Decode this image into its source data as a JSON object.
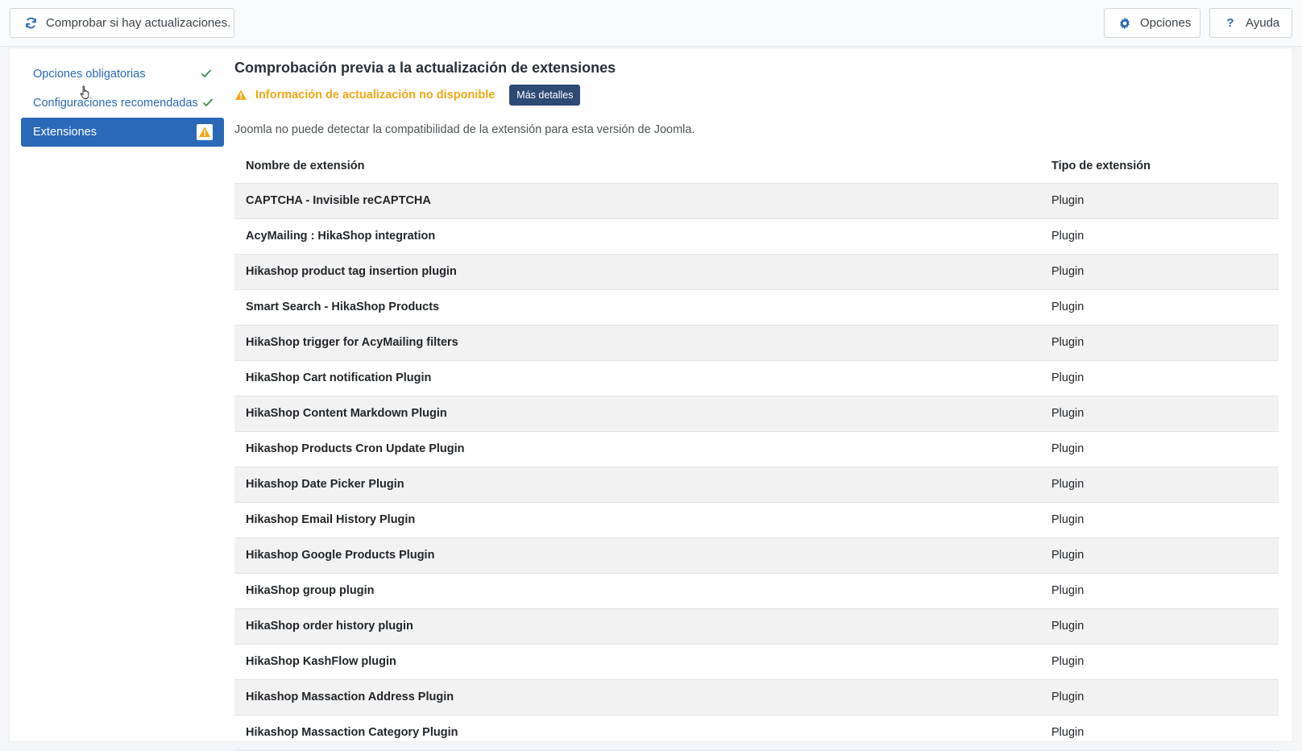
{
  "toolbar": {
    "check_updates_label": "Comprobar si hay actualizaciones.",
    "check_updates_icon": "sync-icon",
    "options_label": "Opciones",
    "options_icon": "gear-icon",
    "help_label": "Ayuda",
    "help_icon": "question-icon"
  },
  "sidebar": {
    "items": [
      {
        "label": "Opciones obligatorias",
        "status": "ok"
      },
      {
        "label": "Configuraciones recomendadas",
        "status": "ok"
      },
      {
        "label": "Extensiones",
        "status": "warning",
        "active": true
      }
    ]
  },
  "main": {
    "title": "Comprobación previa a la actualización de extensiones",
    "warning_text": "Información de actualización no disponible",
    "details_button": "Más detalles",
    "description": "Joomla no puede detectar la compatibilidad de la extensión para esta versión de Joomla.",
    "table": {
      "headers": {
        "name": "Nombre de extensión",
        "type": "Tipo de extensión"
      },
      "rows": [
        {
          "name": "CAPTCHA - Invisible reCAPTCHA",
          "type": "Plugin"
        },
        {
          "name": "AcyMailing : HikaShop integration",
          "type": "Plugin"
        },
        {
          "name": "Hikashop product tag insertion plugin",
          "type": "Plugin"
        },
        {
          "name": "Smart Search - HikaShop Products",
          "type": "Plugin"
        },
        {
          "name": "HikaShop trigger for AcyMailing filters",
          "type": "Plugin"
        },
        {
          "name": "HikaShop Cart notification Plugin",
          "type": "Plugin"
        },
        {
          "name": "HikaShop Content Markdown Plugin",
          "type": "Plugin"
        },
        {
          "name": "Hikashop Products Cron Update Plugin",
          "type": "Plugin"
        },
        {
          "name": "Hikashop Date Picker Plugin",
          "type": "Plugin"
        },
        {
          "name": "Hikashop Email History Plugin",
          "type": "Plugin"
        },
        {
          "name": "Hikashop Google Products Plugin",
          "type": "Plugin"
        },
        {
          "name": "HikaShop group plugin",
          "type": "Plugin"
        },
        {
          "name": "HikaShop order history plugin",
          "type": "Plugin"
        },
        {
          "name": "HikaShop KashFlow plugin",
          "type": "Plugin"
        },
        {
          "name": "Hikashop Massaction Address Plugin",
          "type": "Plugin"
        },
        {
          "name": "Hikashop Massaction Category Plugin",
          "type": "Plugin"
        }
      ]
    }
  },
  "colors": {
    "accent": "#2a69b8",
    "warning": "#f0a716",
    "success": "#3a8a4a",
    "details_button": "#2d4a75"
  }
}
